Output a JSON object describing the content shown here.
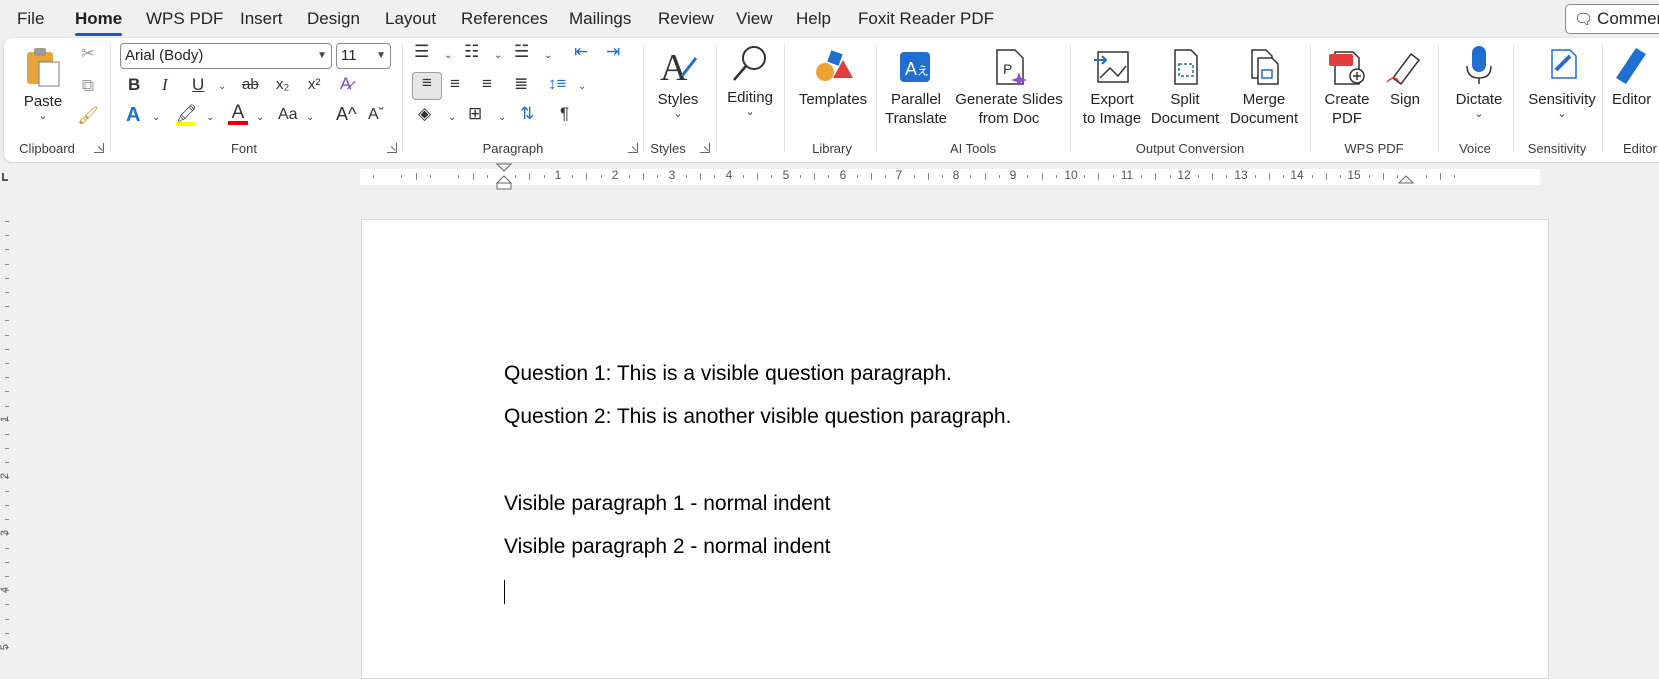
{
  "menu": {
    "tabs": [
      "File",
      "Home",
      "WPS PDF",
      "Insert",
      "Design",
      "Layout",
      "References",
      "Mailings",
      "Review",
      "View",
      "Help",
      "Foxit Reader PDF"
    ],
    "active_tab": "Home",
    "comments_label": "Commen"
  },
  "ribbon": {
    "clipboard": {
      "paste_label": "Paste",
      "group_label": "Clipboard"
    },
    "font": {
      "font_name": "Arial (Body)",
      "font_size": "11",
      "group_label": "Font",
      "bold": "B",
      "italic": "I",
      "underline": "U",
      "strike": "ab",
      "subscript": "x₂",
      "superscript": "x²",
      "text_effects": "A",
      "font_color": "A",
      "change_case": "Aa",
      "grow": "A^",
      "shrink": "Aˇ"
    },
    "paragraph": {
      "group_label": "Paragraph",
      "pilcrow": "¶"
    },
    "styles": {
      "label": "Styles",
      "group_label": "Styles"
    },
    "editing": {
      "label": "Editing"
    },
    "library": {
      "templates_label": "Templates",
      "group_label": "Library"
    },
    "ai_tools": {
      "parallel_translate": [
        "Parallel",
        "Translate"
      ],
      "generate_slides": [
        "Generate Slides",
        "from Doc"
      ],
      "group_label": "AI Tools"
    },
    "output_conversion": {
      "export_to_image": [
        "Export",
        "to Image"
      ],
      "split_document": [
        "Split",
        "Document"
      ],
      "merge_document": [
        "Merge",
        "Document"
      ],
      "group_label": "Output Conversion"
    },
    "wps_pdf": {
      "create_pdf": [
        "Create",
        "PDF"
      ],
      "sign": "Sign",
      "group_label": "WPS PDF",
      "pdf_badge": "PDF"
    },
    "voice": {
      "dictate": "Dictate",
      "group_label": "Voice"
    },
    "sensitivity": {
      "label": "Sensitivity",
      "group_label": "Sensitivity"
    },
    "editor": {
      "label": "Editor",
      "group_label": "Editor"
    }
  },
  "ruler": {
    "numbers": [
      "1",
      "2",
      "3",
      "4",
      "5",
      "6",
      "7",
      "8",
      "9",
      "10",
      "11",
      "12",
      "13",
      "14",
      "15"
    ],
    "vertical_numbers": [
      "1",
      "2",
      "3",
      "4",
      "5"
    ]
  },
  "document": {
    "paragraphs": [
      "Question 1: This is a visible question paragraph.",
      "Question 2: This is another visible question paragraph.",
      "",
      "Visible paragraph 1 - normal indent",
      "Visible paragraph 2 - normal indent"
    ]
  },
  "colors": {
    "accent": "#185abd",
    "highlight": "#ffff00",
    "font_color": "#e00000"
  }
}
